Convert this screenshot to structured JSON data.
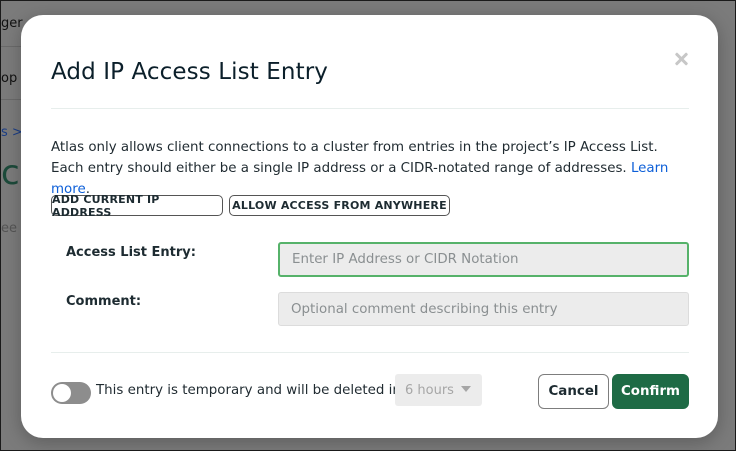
{
  "background": {
    "fragments": [
      "ger",
      "op S",
      "s >",
      "ce",
      "ee"
    ]
  },
  "modal": {
    "title": "Add IP Access List Entry",
    "description": "Atlas only allows client connections to a cluster from entries in the project’s IP Access List. Each entry should either be a single IP address or a CIDR-notated range of addresses.",
    "learn_more": "Learn more",
    "add_current_ip_button": "ADD CURRENT IP ADDRESS",
    "allow_anywhere_button": "ALLOW ACCESS FROM ANYWHERE",
    "access_list_entry": {
      "label": "Access List Entry:",
      "value": "",
      "placeholder": "Enter IP Address or CIDR Notation"
    },
    "comment": {
      "label": "Comment:",
      "value": "",
      "placeholder": "Optional comment describing this entry"
    },
    "temporary": {
      "toggle_on": false,
      "label": "This entry is temporary and will be deleted in",
      "duration_selected": "6 hours"
    },
    "cancel_button": "Cancel",
    "confirm_button": "Confirm",
    "icons": {
      "close": "close-icon",
      "dropdown": "chevron-down-icon"
    }
  },
  "colors": {
    "confirm": "#1e6b45",
    "focus_border": "#56b26a",
    "link": "#0d5fd8"
  }
}
